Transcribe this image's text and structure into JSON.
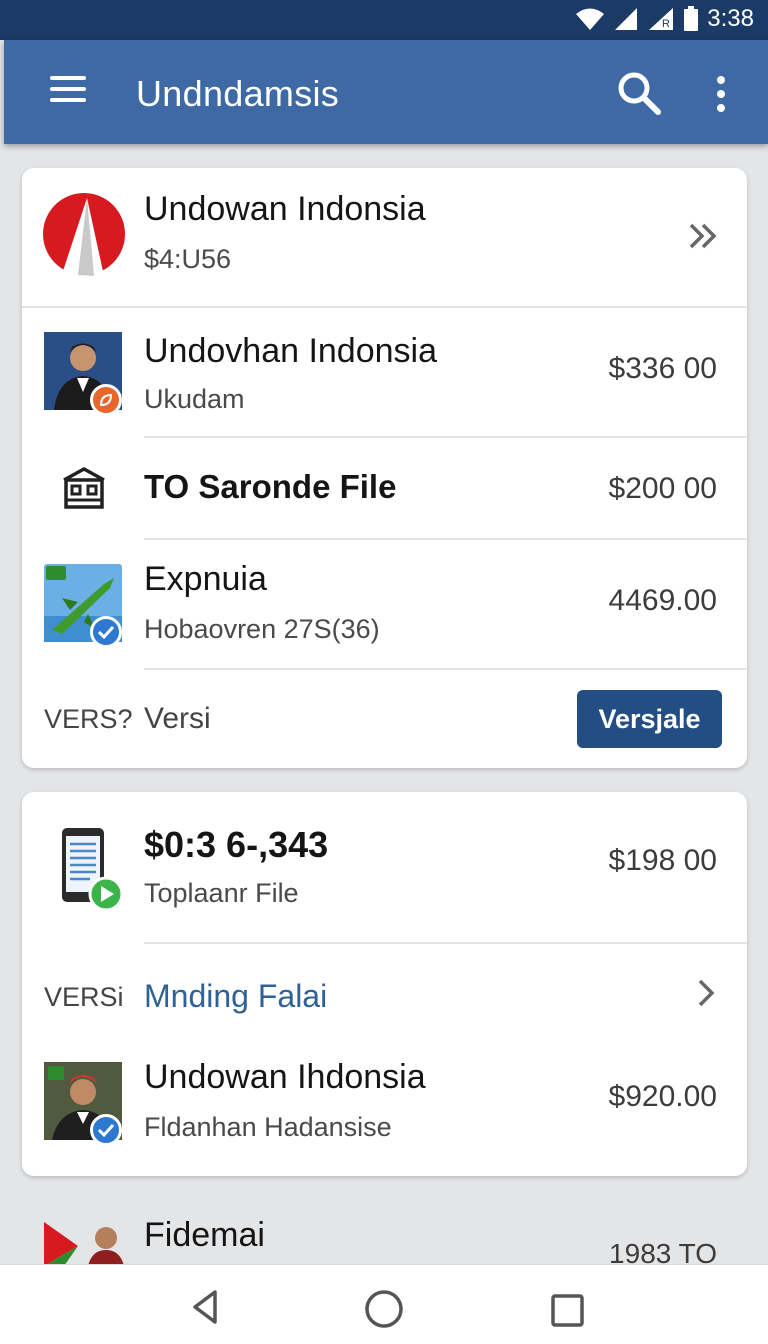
{
  "status_bar": {
    "time": "3:38",
    "icons": [
      "wifi-icon",
      "signal-icon",
      "signal-icon",
      "battery-icon"
    ]
  },
  "app_bar": {
    "title": "Undndamsis",
    "icons": [
      "menu-icon",
      "search-icon",
      "more-vert-icon"
    ]
  },
  "colors": {
    "app_bar": "#3e69a4",
    "status_bar": "#1c3a66",
    "button": "#224e83",
    "link": "#2f6196"
  },
  "card1": {
    "header": {
      "name": "Undowan Indonsia",
      "sub": "$4:U56",
      "icon": "double-chevron-right-icon"
    },
    "items": [
      {
        "name": "Undovhan Indonsia",
        "sub": "Ukudam",
        "amount": "$336 00",
        "thumb": "person-photo",
        "badge": "orange-leaf-badge"
      },
      {
        "name": "TO Saronde File",
        "sub": "",
        "amount": "$200 00",
        "thumb": "building-icon"
      },
      {
        "name": "Expnuia",
        "sub": "Hobaovren 27S(36)",
        "amount": "4469.00",
        "thumb": "airplane-image",
        "badge": "check-badge"
      }
    ],
    "footer": {
      "label1": "VERS?",
      "label2": "Versi",
      "button": "Versjale"
    }
  },
  "card2": {
    "top_item": {
      "name": "$0:3 6-,343",
      "sub": "Toplaanr File",
      "amount": "$198 00",
      "thumb": "phone-document-icon",
      "badge": "play-badge"
    },
    "link_row": {
      "label": "VERSi",
      "link": "Mnding Falai",
      "icon": "chevron-right-icon"
    },
    "bottom_item": {
      "name": "Undowan Ihdonsia",
      "sub": "Fldanhan Hadansise",
      "amount": "$920.00",
      "thumb": "person-photo",
      "badge": "check-badge"
    }
  },
  "peek_item": {
    "name": "Fidemai",
    "amount": "1983 TO"
  },
  "nav_bar": {
    "buttons": [
      "back-icon",
      "home-icon",
      "recents-icon"
    ]
  }
}
